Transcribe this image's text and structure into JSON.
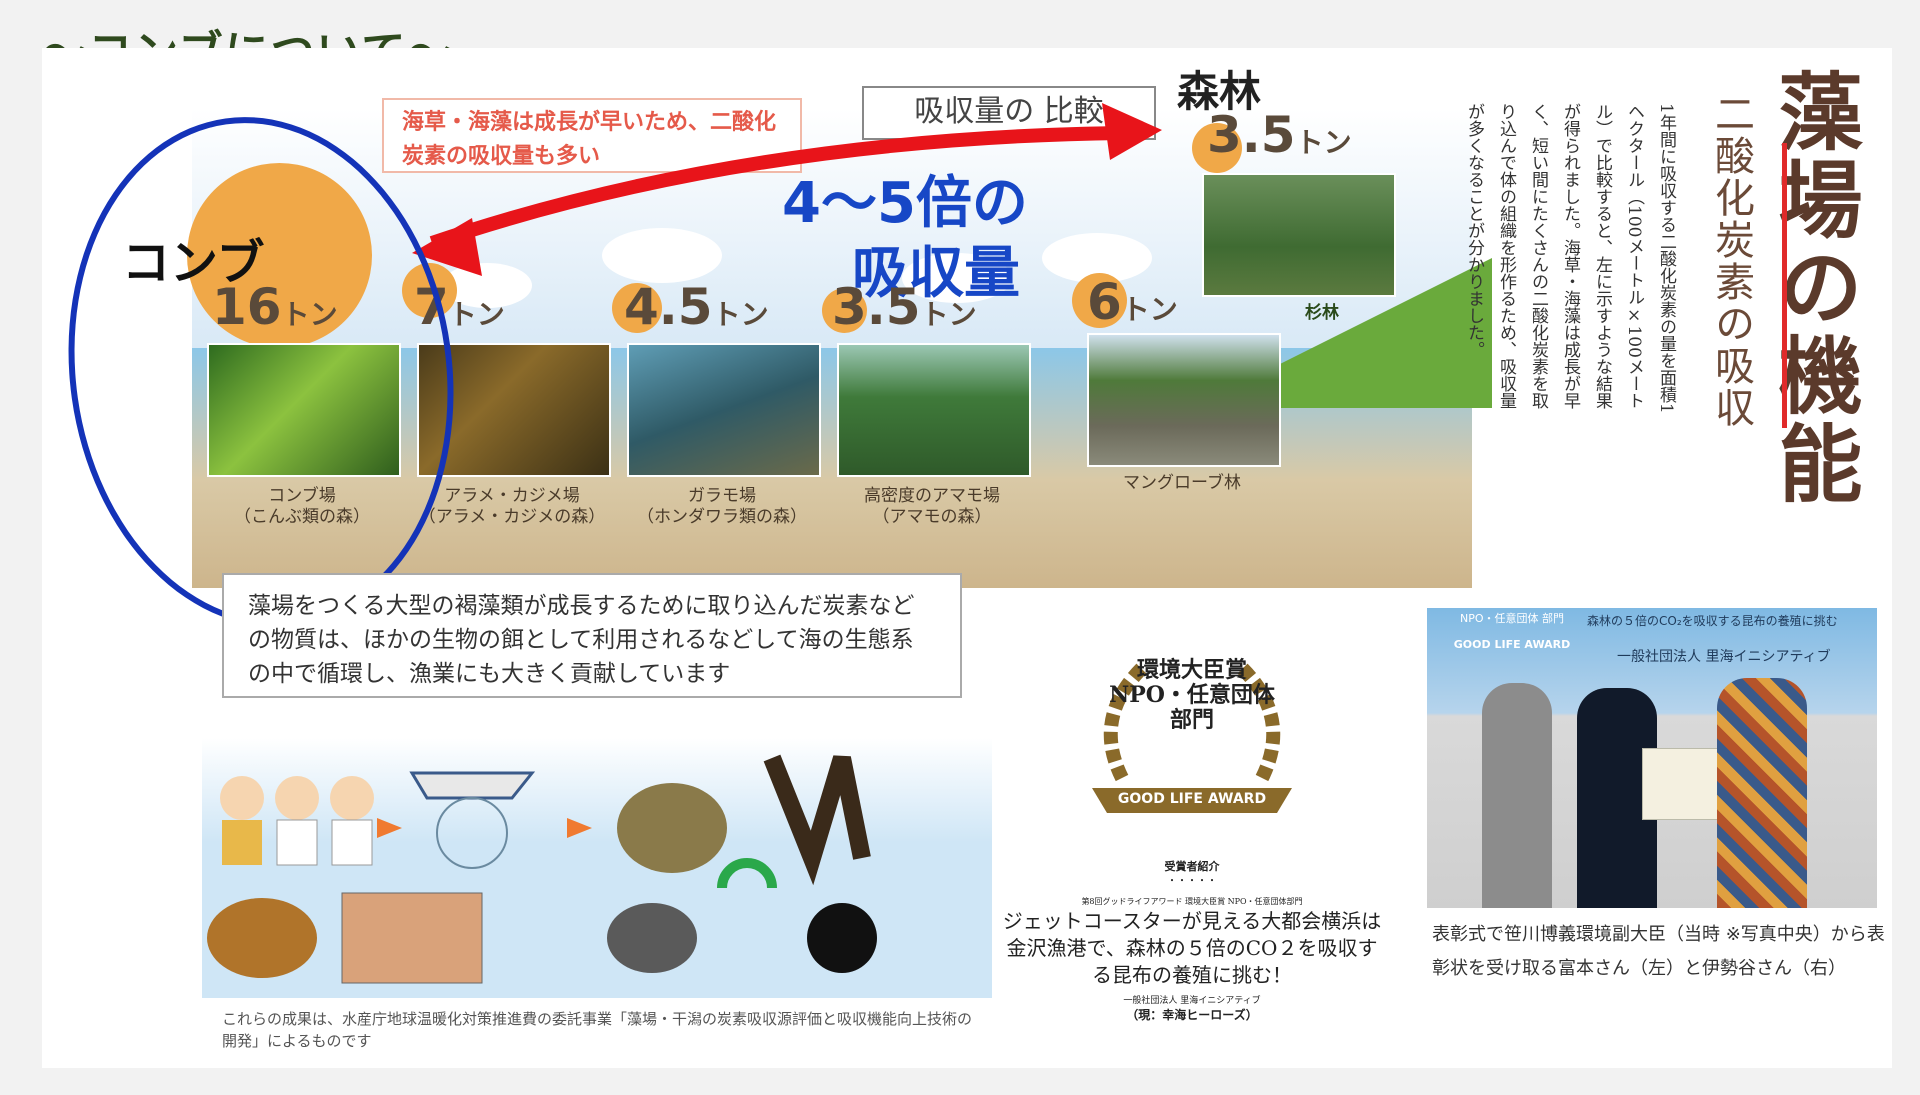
{
  "page_title": "～コンブについて～",
  "infographic": {
    "note": "海草・海藻は成長が早いため、二酸化炭素の吸収量も多い",
    "compare_label": "吸収量の 比較",
    "forest_title": "森林",
    "forest_value": "3.5",
    "unit": "トン",
    "ratio_line1": "4～5倍の",
    "ratio_line2": "吸収量",
    "kombu_label": "コンブ",
    "items": [
      {
        "value": "16",
        "caption1": "コンブ場",
        "caption2": "（こんぶ類の森）"
      },
      {
        "value": "7",
        "caption1": "アラメ・カジメ場",
        "caption2": "（アラメ・カジメの森）"
      },
      {
        "value": "4.5",
        "caption1": "ガラモ場",
        "caption2": "（ホンダワラ類の森）"
      },
      {
        "value": "3.5",
        "caption1": "高密度のアマモ場",
        "caption2": "（アマモの森）"
      },
      {
        "value": "6",
        "caption1": "マングローブ林",
        "caption2": ""
      }
    ],
    "cedar_label": "杉林"
  },
  "side_panel": {
    "title": "藻場の機能",
    "subtitle": "二酸化炭素の吸収",
    "body": "1年間に吸収する二酸化炭素の量を面積1ヘクタール（100メートル×100メートル）で比較すると、左に示すような結果が得られました。海草・海藻は成長が早く、短い間にたくさんの二酸化炭素を取り込んで体の組織を形作るため、吸収量が多くなることが分かりました。"
  },
  "text_box": "藻場をつくる大型の褐藻類が成長するために取り込んだ炭素などの物質は、ほかの生物の餌として利用されるなどして海の生態系の中で循環し、漁業にも大きく貢献しています",
  "footnote": "これらの成果は、水産庁地球温暖化対策推進費の委託事業「藻場・干潟の炭素吸収源評価と吸収機能向上技術の開発」によるものです",
  "award": {
    "badge_line1": "環境大臣賞",
    "badge_line2": "NPO・任意団体",
    "badge_line3": "部門",
    "ribbon": "GOOD LIFE AWARD",
    "intro": "受賞者紹介",
    "dots": "・・・・・",
    "small_line": "第8回グッドライフアワード 環境大臣賞 NPO・任意団体部門",
    "headline": "ジェットコースターが見える大都会横浜は金沢漁港で、森林の５倍のCO２を吸収する昆布の養殖に挑む！",
    "org": "一般社団法人 里海イニシアティブ",
    "org_now": "（現：幸海ヒーローズ）"
  },
  "award_photo": {
    "banner_badge": "NPO・任意団体 部門",
    "banner_award": "GOOD LIFE AWARD",
    "banner_title": "森林の５倍のCO₂を吸収する昆布の養殖に挑む",
    "banner_org": "一般社団法人 里海イニシアティブ",
    "caption": "表彰式で笹川博義環境副大臣（当時 ※写真中央）から表彰状を受け取る富本さん（左）と伊勢谷さん（右）"
  }
}
